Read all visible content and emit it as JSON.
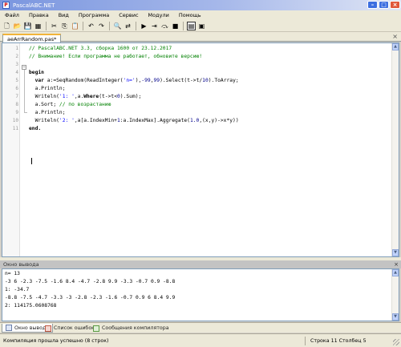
{
  "window": {
    "title": "PascalABC.NET"
  },
  "menu": [
    "Файл",
    "Правка",
    "Вид",
    "Программа",
    "Сервис",
    "Модули",
    "Помощь"
  ],
  "toolbar": {
    "buttons": [
      {
        "name": "new-file-icon",
        "glyph": "🗋"
      },
      {
        "name": "open-file-icon",
        "glyph": "📂"
      },
      {
        "name": "save-icon",
        "glyph": "💾"
      },
      {
        "name": "save-all-icon",
        "glyph": "▦"
      },
      {
        "name": "separator"
      },
      {
        "name": "cut-icon",
        "glyph": "✂"
      },
      {
        "name": "copy-icon",
        "glyph": "⎘"
      },
      {
        "name": "paste-icon",
        "glyph": "📋"
      },
      {
        "name": "separator"
      },
      {
        "name": "undo-icon",
        "glyph": "↶"
      },
      {
        "name": "redo-icon",
        "glyph": "↷"
      },
      {
        "name": "separator"
      },
      {
        "name": "find-icon",
        "glyph": "🔍"
      },
      {
        "name": "replace-icon",
        "glyph": "⇄"
      },
      {
        "name": "separator"
      },
      {
        "name": "run-icon",
        "glyph": "▶"
      },
      {
        "name": "step-into-icon",
        "glyph": "⇥"
      },
      {
        "name": "step-over-icon",
        "glyph": "⤼"
      },
      {
        "name": "stop-icon",
        "glyph": "■"
      },
      {
        "name": "separator"
      },
      {
        "name": "output-window-icon",
        "glyph": "▤"
      },
      {
        "name": "form-designer-icon",
        "glyph": "▣"
      }
    ]
  },
  "editor": {
    "tab_label": "aeArrRandom.pas*",
    "line_numbers": [
      "1",
      "2",
      "3",
      "4",
      "5",
      "6",
      "7",
      "8",
      "9",
      "10",
      "11"
    ],
    "lines": [
      [
        {
          "t": "// PascalABC.NET 3.3, сборка 1600 от 23.12.2017",
          "c": "cm"
        }
      ],
      [
        {
          "t": "// Внимание! Если программа не работает, обновите версию!",
          "c": "cm"
        }
      ],
      [],
      [
        {
          "t": "begin",
          "c": "kw"
        }
      ],
      [
        {
          "t": "  "
        },
        {
          "t": "var",
          "c": "kw"
        },
        {
          "t": " a:=SeqRandom(ReadInteger("
        },
        {
          "t": "'n='",
          "c": "str"
        },
        {
          "t": "),"
        },
        {
          "t": "-99",
          "c": "num"
        },
        {
          "t": ","
        },
        {
          "t": "99",
          "c": "num"
        },
        {
          "t": ").Select(t->t/"
        },
        {
          "t": "10",
          "c": "num"
        },
        {
          "t": ").ToArray;"
        }
      ],
      [
        {
          "t": "  a.Println;"
        }
      ],
      [
        {
          "t": "  Writeln("
        },
        {
          "t": "'1: '",
          "c": "str"
        },
        {
          "t": ",a."
        },
        {
          "t": "Where",
          "c": "kw"
        },
        {
          "t": "(t->t<"
        },
        {
          "t": "0",
          "c": "num"
        },
        {
          "t": ").Sum);"
        }
      ],
      [
        {
          "t": "  a.Sort; "
        },
        {
          "t": "// по возрастанию",
          "c": "cm"
        }
      ],
      [
        {
          "t": "  a.Println;"
        }
      ],
      [
        {
          "t": "  Writeln("
        },
        {
          "t": "'2: '",
          "c": "str"
        },
        {
          "t": ",a[a.IndexMin+"
        },
        {
          "t": "1",
          "c": "num"
        },
        {
          "t": ":a.IndexMax].Aggregate("
        },
        {
          "t": "1.0",
          "c": "num"
        },
        {
          "t": ",(x,y)->x*y))"
        }
      ],
      [
        {
          "t": "end.",
          "c": "kw"
        }
      ]
    ]
  },
  "output": {
    "header": "Окно вывода",
    "lines": [
      "n= 13",
      "-3 6 -2.3 -7.5 -1.6 8.4 -4.7 -2.8 9.9 -3.3 -0.7 0.9 -8.8",
      "1: -34.7",
      "-8.8 -7.5 -4.7 -3.3 -3 -2.8 -2.3 -1.6 -0.7 0.9 6 8.4 9.9",
      "2: 114175.0608768"
    ]
  },
  "bottom_tabs": [
    "Окно вывода",
    "Список ошибок",
    "Сообщения компилятора"
  ],
  "status": {
    "message": "Компиляция прошла успешно (8 строк)",
    "line_label": "Строка  11",
    "col_label": "Столбец  5"
  }
}
